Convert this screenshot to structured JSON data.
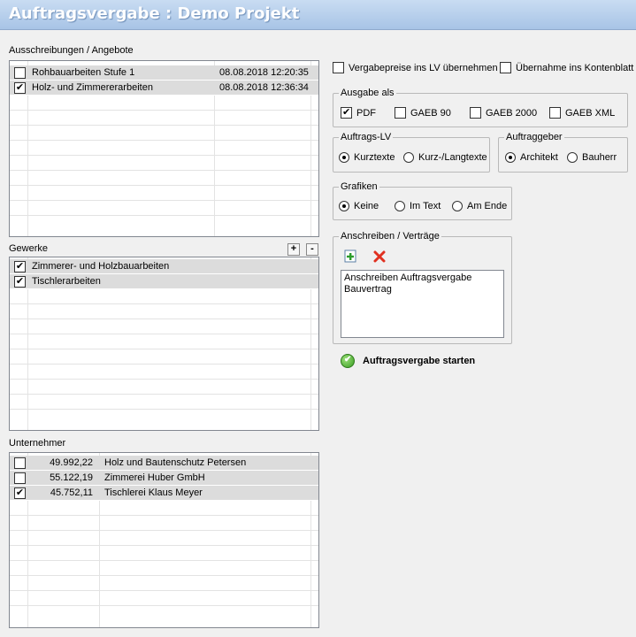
{
  "window": {
    "title": "Auftragsvergabe : Demo Projekt"
  },
  "ausschreibungen": {
    "label": "Ausschreibungen / Angebote",
    "rows": [
      {
        "name": "Rohbauarbeiten Stufe 1",
        "date": "08.08.2018 12:20:35",
        "checked": false
      },
      {
        "name": "Holz- und Zimmererarbeiten",
        "date": "08.08.2018 12:36:34",
        "checked": true
      }
    ]
  },
  "gewerke": {
    "label": "Gewerke",
    "add_label": "+",
    "remove_label": "-",
    "rows": [
      {
        "name": "Zimmerer- und Holzbauarbeiten",
        "checked": true
      },
      {
        "name": "Tischlerarbeiten",
        "checked": true
      }
    ]
  },
  "unternehmer": {
    "label": "Unternehmer",
    "rows": [
      {
        "amount": "49.992,22",
        "name": "Holz und Bautenschutz Petersen",
        "checked": false
      },
      {
        "amount": "55.122,19",
        "name": "Zimmerei Huber GmbH",
        "checked": false
      },
      {
        "amount": "45.752,11",
        "name": "Tischlerei Klaus Meyer",
        "checked": true
      }
    ]
  },
  "options": {
    "vergabepreise": {
      "label": "Vergabepreise ins LV übernehmen",
      "checked": false
    },
    "kontenblatt": {
      "label": "Übernahme ins Kontenblatt",
      "checked": false
    }
  },
  "ausgabe": {
    "legend": "Ausgabe als",
    "items": [
      {
        "label": "PDF",
        "checked": true
      },
      {
        "label": "GAEB 90",
        "checked": false
      },
      {
        "label": "GAEB 2000",
        "checked": false
      },
      {
        "label": "GAEB XML",
        "checked": false
      }
    ]
  },
  "auftrags_lv": {
    "legend": "Auftrags-LV",
    "items": [
      {
        "label": "Kurztexte",
        "selected": true
      },
      {
        "label": "Kurz-/Langtexte",
        "selected": false
      }
    ]
  },
  "auftraggeber": {
    "legend": "Auftraggeber",
    "items": [
      {
        "label": "Architekt",
        "selected": true
      },
      {
        "label": "Bauherr",
        "selected": false
      }
    ]
  },
  "grafiken": {
    "legend": "Grafiken",
    "items": [
      {
        "label": "Keine",
        "selected": true
      },
      {
        "label": "Im Text",
        "selected": false
      },
      {
        "label": "Am Ende",
        "selected": false
      }
    ]
  },
  "anschreiben": {
    "legend": "Anschreiben / Verträge",
    "items": [
      "Anschreiben Auftragsvergabe",
      "Bauvertrag"
    ]
  },
  "start_button": {
    "label": "Auftragsvergabe starten"
  }
}
